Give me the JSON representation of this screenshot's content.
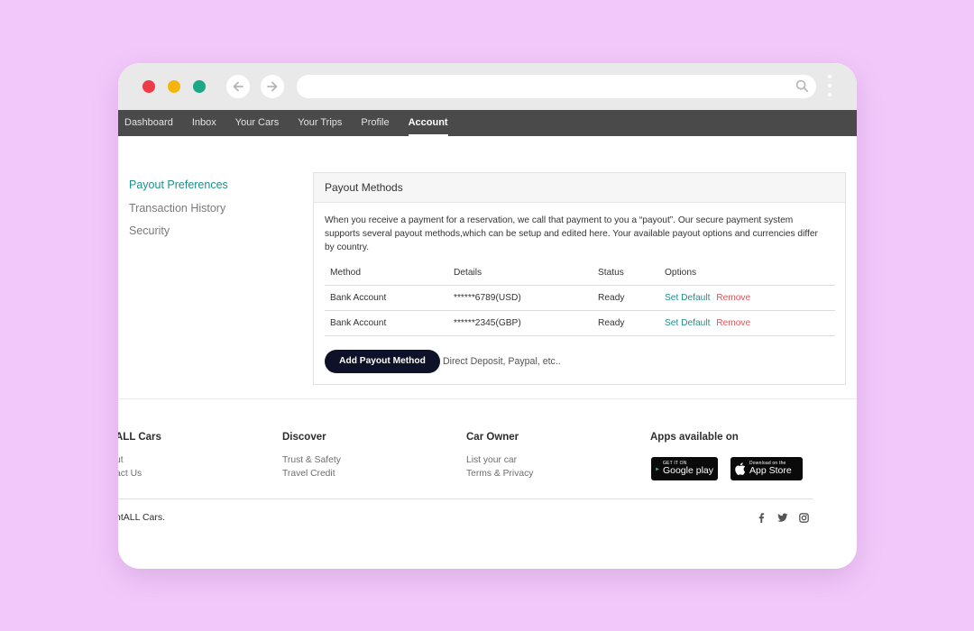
{
  "browser": {
    "colors": {
      "close": "#ee3b48",
      "minimize": "#f6b40e",
      "maximize": "#1aa886"
    },
    "icons": [
      "arrow-left-icon",
      "arrow-right-icon",
      "search-icon",
      "kebab-menu-icon"
    ]
  },
  "topnav": {
    "items": [
      "Dashboard",
      "Inbox",
      "Your Cars",
      "Your Trips",
      "Profile",
      "Account"
    ],
    "active": "Account"
  },
  "sidebar": {
    "items": [
      "Payout Preferences",
      "Transaction History",
      "Security"
    ],
    "active": "Payout Preferences",
    "accent_color": "#1d8f8b"
  },
  "payout": {
    "title": "Payout Methods",
    "description": "When you receive a payment for a reservation, we call that payment to you a “payout”. Our secure payment system supports several payout methods,which can be setup and edited here. Your available payout options and currencies differ by country.",
    "columns": [
      "Method",
      "Details",
      "Status",
      "Options"
    ],
    "rows": [
      {
        "method": "Bank Account",
        "details": "******6789(USD)",
        "status": "Ready",
        "set_default": "Set Default",
        "remove": "Remove"
      },
      {
        "method": "Bank Account",
        "details": "******2345(GBP)",
        "status": "Ready",
        "set_default": "Set Default",
        "remove": "Remove"
      }
    ],
    "add_button": "Add Payout Method",
    "add_hint": "Direct Deposit, Paypal, etc.."
  },
  "footer": {
    "col1": {
      "heading": "ALL Cars",
      "links": [
        "ut",
        "act Us"
      ]
    },
    "col2": {
      "heading": "Discover",
      "links": [
        "Trust & Safety",
        "Travel Credit"
      ]
    },
    "col3": {
      "heading": "Car Owner",
      "links": [
        "List your car",
        "Terms & Privacy"
      ]
    },
    "col4": {
      "heading": "Apps available on",
      "google_play": {
        "small": "GET IT ON",
        "big": "Google play"
      },
      "app_store": {
        "small": "Download on the",
        "big": "App Store"
      }
    },
    "copyright": "ntALL Cars.",
    "social_icons": [
      "facebook-icon",
      "twitter-icon",
      "instagram-icon"
    ]
  }
}
